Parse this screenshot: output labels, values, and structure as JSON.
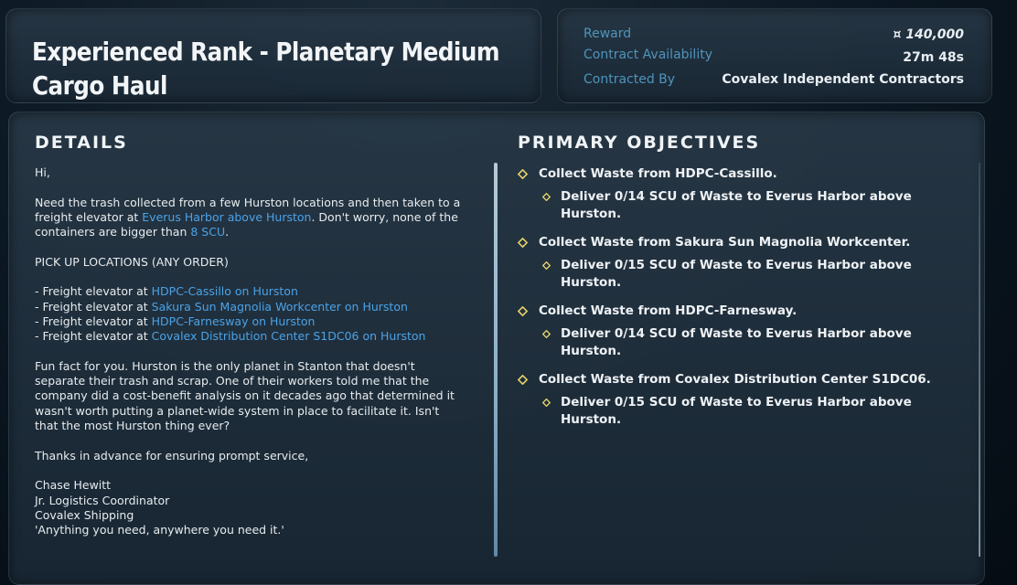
{
  "title": "Experienced Rank - Planetary Medium Cargo Haul",
  "info": {
    "reward_label": "Reward",
    "reward_value": "¤ 140,000",
    "availability_label": "Contract Availability",
    "availability_value": "27m 48s",
    "contracted_label": "Contracted By",
    "contracted_value": "Covalex Independent Contractors"
  },
  "details": {
    "heading": "DETAILS",
    "greeting": "Hi,",
    "intro_1": "Need the trash collected from a few Hurston locations and then taken to a freight elevator at ",
    "intro_link_1": "Everus Harbor above Hurston",
    "intro_2": ". Don't worry, none of the containers are bigger than ",
    "intro_link_2": "8 SCU",
    "intro_3": ".",
    "pickup_heading": "PICK UP LOCATIONS (ANY ORDER)",
    "pickup_prefix": "- Freight elevator at ",
    "pickups": [
      "HDPC-Cassillo on Hurston",
      "Sakura Sun Magnolia Workcenter on Hurston",
      "HDPC-Farnesway on Hurston",
      "Covalex Distribution Center S1DC06 on Hurston"
    ],
    "fun_fact": "Fun fact for you. Hurston is the only planet in Stanton that doesn't separate their trash and scrap. One of their workers told me that the company did a cost-benefit analysis on it decades ago that determined it wasn't worth putting a planet-wide system in place to facilitate it. Isn't that the most Hurston thing ever?",
    "thanks": "Thanks in advance for ensuring prompt service,",
    "signature": [
      "Chase Hewitt",
      "Jr. Logistics Coordinator",
      "Covalex Shipping",
      "'Anything you need, anywhere you need it.'"
    ]
  },
  "objectives": {
    "heading": "PRIMARY OBJECTIVES",
    "items": [
      {
        "main": "Collect Waste from HDPC-Cassillo.",
        "sub": "Deliver 0/14 SCU of Waste to Everus Harbor above Hurston."
      },
      {
        "main": "Collect Waste from Sakura Sun Magnolia Workcenter.",
        "sub": "Deliver 0/15 SCU of Waste to Everus Harbor above Hurston."
      },
      {
        "main": "Collect Waste from HDPC-Farnesway.",
        "sub": "Deliver 0/14 SCU of Waste to Everus Harbor above Hurston."
      },
      {
        "main": "Collect Waste from Covalex Distribution Center S1DC06.",
        "sub": "Deliver 0/15 SCU of Waste to Everus Harbor above Hurston."
      }
    ]
  },
  "colors": {
    "accent_link": "#4aa3e8",
    "label_blue": "#4f94bb",
    "objective_diamond": "#e7d36a"
  }
}
